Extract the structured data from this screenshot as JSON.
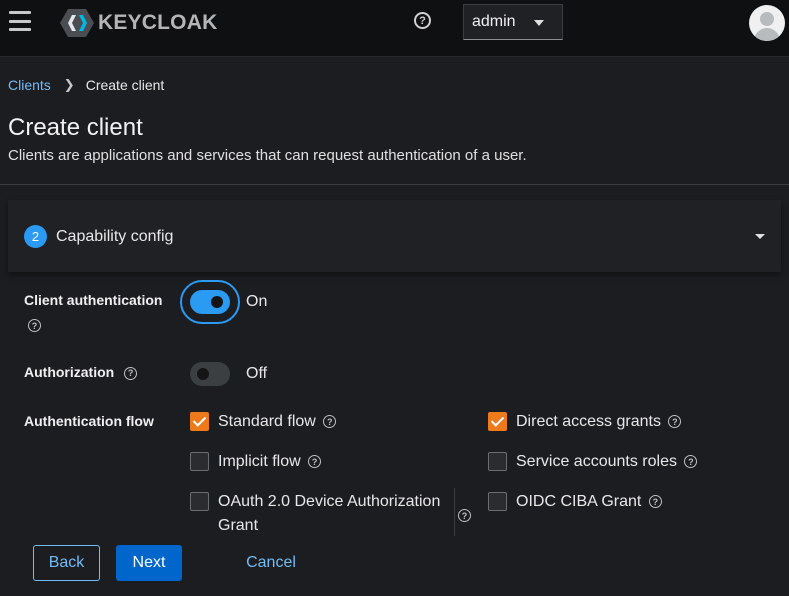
{
  "header": {
    "logo_text": "KEYCLOAK",
    "help_icon": "?",
    "user_name": "admin"
  },
  "breadcrumb": {
    "parent": "Clients",
    "current": "Create client"
  },
  "page": {
    "title": "Create client",
    "description": "Clients are applications and services that can request authentication of a user."
  },
  "step": {
    "number": "2",
    "label": "Capability config"
  },
  "fields": {
    "client_authentication": {
      "label": "Client authentication",
      "state": "On"
    },
    "authorization": {
      "label": "Authorization",
      "state": "Off"
    },
    "authentication_flow": {
      "label": "Authentication flow"
    }
  },
  "flows": {
    "standard": "Standard flow",
    "implicit": "Implicit flow",
    "oauth_device_line1": "OAuth 2.0 Device Authorization",
    "oauth_device_line2": "Grant",
    "direct_access": "Direct access grants",
    "service_accounts": "Service accounts roles",
    "oidc_ciba": "OIDC CIBA Grant"
  },
  "flow_states": {
    "standard": true,
    "implicit": false,
    "oauth_device": false,
    "direct_access": true,
    "service_accounts": false,
    "oidc_ciba": false
  },
  "buttons": {
    "back": "Back",
    "next": "Next",
    "cancel": "Cancel"
  },
  "colors": {
    "accent": "#2b9af3",
    "primary_button": "#0066cc",
    "checkbox_checked": "#ee7a1c",
    "link": "#73bcf7"
  }
}
